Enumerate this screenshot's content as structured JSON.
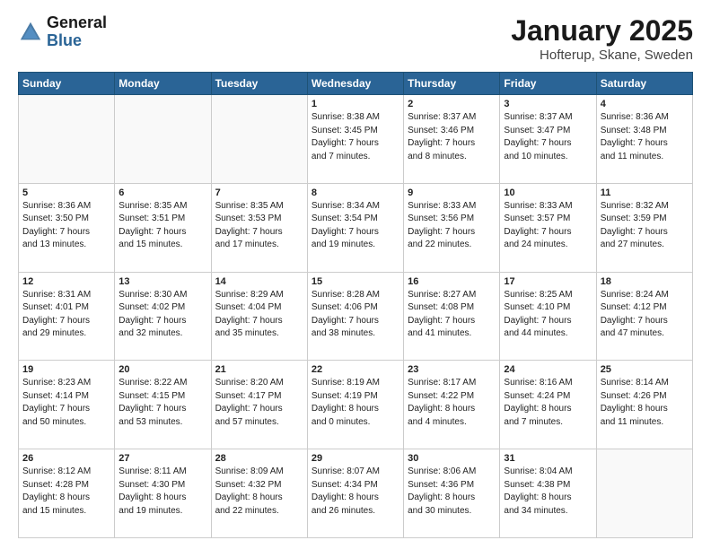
{
  "logo": {
    "general": "General",
    "blue": "Blue"
  },
  "title": "January 2025",
  "subtitle": "Hofterup, Skane, Sweden",
  "days_of_week": [
    "Sunday",
    "Monday",
    "Tuesday",
    "Wednesday",
    "Thursday",
    "Friday",
    "Saturday"
  ],
  "weeks": [
    [
      {
        "num": "",
        "info": ""
      },
      {
        "num": "",
        "info": ""
      },
      {
        "num": "",
        "info": ""
      },
      {
        "num": "1",
        "info": "Sunrise: 8:38 AM\nSunset: 3:45 PM\nDaylight: 7 hours\nand 7 minutes."
      },
      {
        "num": "2",
        "info": "Sunrise: 8:37 AM\nSunset: 3:46 PM\nDaylight: 7 hours\nand 8 minutes."
      },
      {
        "num": "3",
        "info": "Sunrise: 8:37 AM\nSunset: 3:47 PM\nDaylight: 7 hours\nand 10 minutes."
      },
      {
        "num": "4",
        "info": "Sunrise: 8:36 AM\nSunset: 3:48 PM\nDaylight: 7 hours\nand 11 minutes."
      }
    ],
    [
      {
        "num": "5",
        "info": "Sunrise: 8:36 AM\nSunset: 3:50 PM\nDaylight: 7 hours\nand 13 minutes."
      },
      {
        "num": "6",
        "info": "Sunrise: 8:35 AM\nSunset: 3:51 PM\nDaylight: 7 hours\nand 15 minutes."
      },
      {
        "num": "7",
        "info": "Sunrise: 8:35 AM\nSunset: 3:53 PM\nDaylight: 7 hours\nand 17 minutes."
      },
      {
        "num": "8",
        "info": "Sunrise: 8:34 AM\nSunset: 3:54 PM\nDaylight: 7 hours\nand 19 minutes."
      },
      {
        "num": "9",
        "info": "Sunrise: 8:33 AM\nSunset: 3:56 PM\nDaylight: 7 hours\nand 22 minutes."
      },
      {
        "num": "10",
        "info": "Sunrise: 8:33 AM\nSunset: 3:57 PM\nDaylight: 7 hours\nand 24 minutes."
      },
      {
        "num": "11",
        "info": "Sunrise: 8:32 AM\nSunset: 3:59 PM\nDaylight: 7 hours\nand 27 minutes."
      }
    ],
    [
      {
        "num": "12",
        "info": "Sunrise: 8:31 AM\nSunset: 4:01 PM\nDaylight: 7 hours\nand 29 minutes."
      },
      {
        "num": "13",
        "info": "Sunrise: 8:30 AM\nSunset: 4:02 PM\nDaylight: 7 hours\nand 32 minutes."
      },
      {
        "num": "14",
        "info": "Sunrise: 8:29 AM\nSunset: 4:04 PM\nDaylight: 7 hours\nand 35 minutes."
      },
      {
        "num": "15",
        "info": "Sunrise: 8:28 AM\nSunset: 4:06 PM\nDaylight: 7 hours\nand 38 minutes."
      },
      {
        "num": "16",
        "info": "Sunrise: 8:27 AM\nSunset: 4:08 PM\nDaylight: 7 hours\nand 41 minutes."
      },
      {
        "num": "17",
        "info": "Sunrise: 8:25 AM\nSunset: 4:10 PM\nDaylight: 7 hours\nand 44 minutes."
      },
      {
        "num": "18",
        "info": "Sunrise: 8:24 AM\nSunset: 4:12 PM\nDaylight: 7 hours\nand 47 minutes."
      }
    ],
    [
      {
        "num": "19",
        "info": "Sunrise: 8:23 AM\nSunset: 4:14 PM\nDaylight: 7 hours\nand 50 minutes."
      },
      {
        "num": "20",
        "info": "Sunrise: 8:22 AM\nSunset: 4:15 PM\nDaylight: 7 hours\nand 53 minutes."
      },
      {
        "num": "21",
        "info": "Sunrise: 8:20 AM\nSunset: 4:17 PM\nDaylight: 7 hours\nand 57 minutes."
      },
      {
        "num": "22",
        "info": "Sunrise: 8:19 AM\nSunset: 4:19 PM\nDaylight: 8 hours\nand 0 minutes."
      },
      {
        "num": "23",
        "info": "Sunrise: 8:17 AM\nSunset: 4:22 PM\nDaylight: 8 hours\nand 4 minutes."
      },
      {
        "num": "24",
        "info": "Sunrise: 8:16 AM\nSunset: 4:24 PM\nDaylight: 8 hours\nand 7 minutes."
      },
      {
        "num": "25",
        "info": "Sunrise: 8:14 AM\nSunset: 4:26 PM\nDaylight: 8 hours\nand 11 minutes."
      }
    ],
    [
      {
        "num": "26",
        "info": "Sunrise: 8:12 AM\nSunset: 4:28 PM\nDaylight: 8 hours\nand 15 minutes."
      },
      {
        "num": "27",
        "info": "Sunrise: 8:11 AM\nSunset: 4:30 PM\nDaylight: 8 hours\nand 19 minutes."
      },
      {
        "num": "28",
        "info": "Sunrise: 8:09 AM\nSunset: 4:32 PM\nDaylight: 8 hours\nand 22 minutes."
      },
      {
        "num": "29",
        "info": "Sunrise: 8:07 AM\nSunset: 4:34 PM\nDaylight: 8 hours\nand 26 minutes."
      },
      {
        "num": "30",
        "info": "Sunrise: 8:06 AM\nSunset: 4:36 PM\nDaylight: 8 hours\nand 30 minutes."
      },
      {
        "num": "31",
        "info": "Sunrise: 8:04 AM\nSunset: 4:38 PM\nDaylight: 8 hours\nand 34 minutes."
      },
      {
        "num": "",
        "info": ""
      }
    ]
  ]
}
